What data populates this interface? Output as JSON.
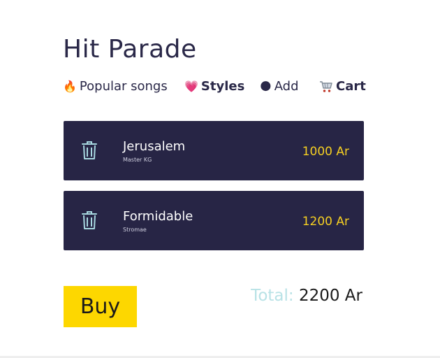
{
  "page": {
    "title": "Hit Parade"
  },
  "nav": {
    "items": [
      {
        "emoji": "🔥",
        "label": "Popular songs",
        "bold": false
      },
      {
        "emoji": "💗",
        "label": "Styles",
        "bold": true
      },
      {
        "emoji": "🌑",
        "label": "Add",
        "bold": false
      },
      {
        "emoji": "cart-icon",
        "label": "Cart",
        "bold": true
      }
    ]
  },
  "cart": {
    "items": [
      {
        "name": "Jerusalem",
        "artist": "Master KG",
        "price": "1000 Ar"
      },
      {
        "name": "Formidable",
        "artist": "Stromae",
        "price": "1200 Ar"
      }
    ],
    "buy_label": "Buy",
    "total_label": "Total:",
    "total_value": "2200 Ar"
  },
  "colors": {
    "card_bg": "#272545",
    "price": "#f5cf22",
    "buy_bg": "#fdd700",
    "total_label": "#b8e2e6",
    "trash_icon": "#a8d8e0"
  }
}
